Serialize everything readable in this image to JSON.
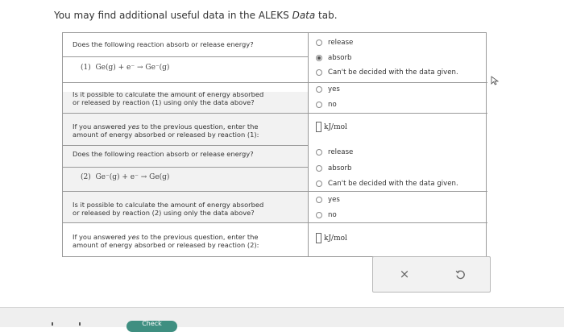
{
  "instruction": {
    "before": "You may find additional useful data in the ALEKS ",
    "italic": "Data",
    "after": " tab."
  },
  "rows": [
    {
      "question": "Does the following reaction absorb or release energy?",
      "equation": {
        "num": "(1)",
        "text": "Ge(g) + e⁻ → Ge⁻(g)"
      },
      "options": [
        {
          "label": "release",
          "selected": false
        },
        {
          "label": "absorb",
          "selected": true
        },
        {
          "label": "Can't be decided with the data given.",
          "selected": false
        }
      ]
    },
    {
      "question_line1": "Is it possible to calculate the amount of energy absorbed",
      "question_line2": "or released by reaction (1) using only the data above?",
      "options": [
        {
          "label": "yes",
          "selected": false
        },
        {
          "label": "no",
          "selected": false
        }
      ]
    },
    {
      "question_line1_pre": "If you answered ",
      "question_line1_italic": "yes",
      "question_line1_post": " to the previous question, enter the",
      "question_line2": "amount of energy absorbed or released by reaction (1):",
      "unit": "kJ/mol",
      "value": ""
    },
    {
      "question": "Does the following reaction absorb or release energy?",
      "equation": {
        "num": "(2)",
        "text": "Ge⁻(g) + e⁻ → Ge(g)"
      },
      "options": [
        {
          "label": "release",
          "selected": false
        },
        {
          "label": "absorb",
          "selected": false
        },
        {
          "label": "Can't be decided with the data given.",
          "selected": false
        }
      ]
    },
    {
      "question_line1": "Is it possible to calculate the amount of energy absorbed",
      "question_line2": "or released by reaction (2) using only the data above?",
      "options": [
        {
          "label": "yes",
          "selected": false
        },
        {
          "label": "no",
          "selected": false
        }
      ]
    },
    {
      "question_line1_pre": "If you answered ",
      "question_line1_italic": "yes",
      "question_line1_post": " to the previous question, enter the",
      "question_line2": "amount of energy absorbed or released by reaction (2):",
      "unit": "kJ/mol",
      "value": ""
    }
  ],
  "panel": {
    "clear_icon": "×",
    "undo_icon": "undo-icon"
  },
  "bottom_button": {
    "label": "Check"
  }
}
